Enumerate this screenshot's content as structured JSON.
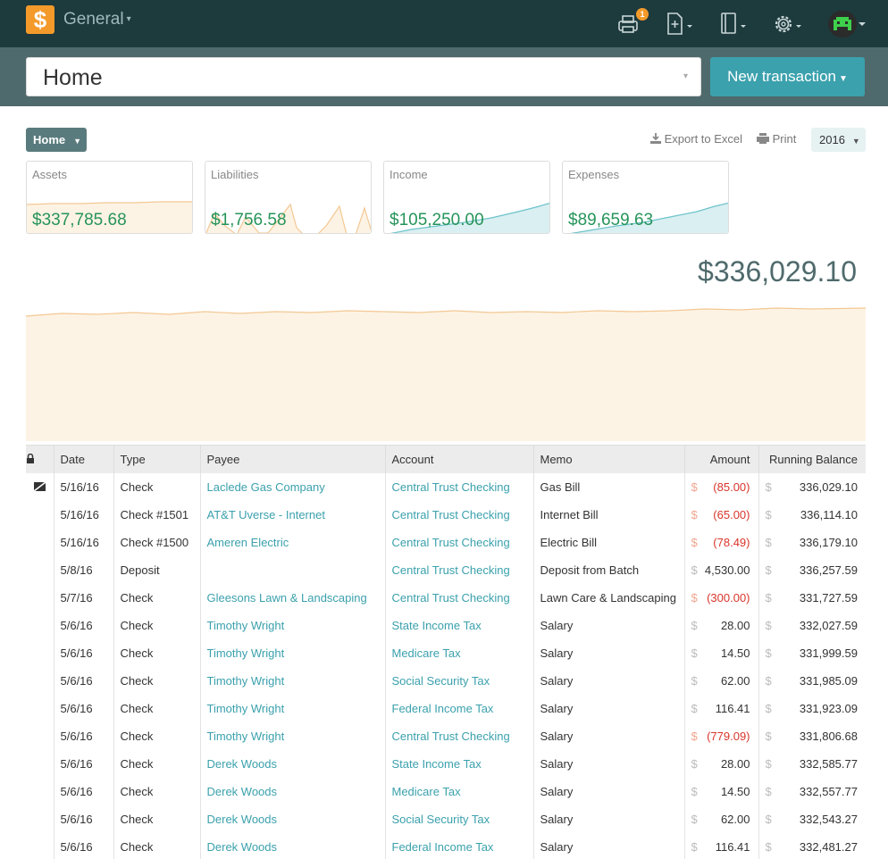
{
  "topbar": {
    "logo_glyph": "$",
    "company": "General",
    "caret": "▾",
    "print_badge": "1",
    "icons": [
      "printer-icon",
      "new-document-icon",
      "ledger-icon",
      "gear-icon",
      "user-avatar"
    ]
  },
  "search": {
    "value": "Home",
    "arrow": "▾",
    "new_transaction_label": "New transaction"
  },
  "toolbar": {
    "home_button": "Home",
    "export_label": "Export to Excel",
    "print_label": "Print",
    "year": "2016"
  },
  "cards": [
    {
      "label": "Assets",
      "amount": "$337,785.68"
    },
    {
      "label": "Liabilities",
      "amount": "$1,756.58"
    },
    {
      "label": "Income",
      "amount": "$105,250.00"
    },
    {
      "label": "Expenses",
      "amount": "$89,659.63"
    }
  ],
  "balance": "$336,029.10",
  "table": {
    "headers": {
      "date": "Date",
      "type": "Type",
      "payee": "Payee",
      "account": "Account",
      "memo": "Memo",
      "amount": "Amount",
      "running": "Running Balance"
    },
    "currency": "$",
    "rows": [
      {
        "icon": true,
        "date": "5/16/16",
        "type": "Check",
        "payee": "Laclede Gas Company",
        "account": "Central Trust Checking",
        "memo": "Gas Bill",
        "amount": "(85.00)",
        "negative": true,
        "running": "336,029.10"
      },
      {
        "icon": false,
        "date": "5/16/16",
        "type": "Check #1501",
        "payee": "AT&T Uverse - Internet",
        "account": "Central Trust Checking",
        "memo": "Internet Bill",
        "amount": "(65.00)",
        "negative": true,
        "running": "336,114.10"
      },
      {
        "icon": false,
        "date": "5/16/16",
        "type": "Check #1500",
        "payee": "Ameren Electric",
        "account": "Central Trust Checking",
        "memo": "Electric Bill",
        "amount": "(78.49)",
        "negative": true,
        "running": "336,179.10"
      },
      {
        "icon": false,
        "date": "5/8/16",
        "type": "Deposit",
        "payee": "",
        "account": "Central Trust Checking",
        "memo": "Deposit from Batch",
        "amount": "4,530.00",
        "negative": false,
        "running": "336,257.59"
      },
      {
        "icon": false,
        "date": "5/7/16",
        "type": "Check",
        "payee": "Gleesons Lawn & Landscaping",
        "account": "Central Trust Checking",
        "memo": "Lawn Care & Landscaping",
        "amount": "(300.00)",
        "negative": true,
        "running": "331,727.59"
      },
      {
        "icon": false,
        "date": "5/6/16",
        "type": "Check",
        "payee": "Timothy Wright",
        "account": "State Income Tax",
        "memo": "Salary",
        "amount": "28.00",
        "negative": false,
        "running": "332,027.59"
      },
      {
        "icon": false,
        "date": "5/6/16",
        "type": "Check",
        "payee": "Timothy Wright",
        "account": "Medicare Tax",
        "memo": "Salary",
        "amount": "14.50",
        "negative": false,
        "running": "331,999.59"
      },
      {
        "icon": false,
        "date": "5/6/16",
        "type": "Check",
        "payee": "Timothy Wright",
        "account": "Social Security Tax",
        "memo": "Salary",
        "amount": "62.00",
        "negative": false,
        "running": "331,985.09"
      },
      {
        "icon": false,
        "date": "5/6/16",
        "type": "Check",
        "payee": "Timothy Wright",
        "account": "Federal Income Tax",
        "memo": "Salary",
        "amount": "116.41",
        "negative": false,
        "running": "331,923.09"
      },
      {
        "icon": false,
        "date": "5/6/16",
        "type": "Check",
        "payee": "Timothy Wright",
        "account": "Central Trust Checking",
        "memo": "Salary",
        "amount": "(779.09)",
        "negative": true,
        "running": "331,806.68"
      },
      {
        "icon": false,
        "date": "5/6/16",
        "type": "Check",
        "payee": "Derek Woods",
        "account": "State Income Tax",
        "memo": "Salary",
        "amount": "28.00",
        "negative": false,
        "running": "332,585.77"
      },
      {
        "icon": false,
        "date": "5/6/16",
        "type": "Check",
        "payee": "Derek Woods",
        "account": "Medicare Tax",
        "memo": "Salary",
        "amount": "14.50",
        "negative": false,
        "running": "332,557.77"
      },
      {
        "icon": false,
        "date": "5/6/16",
        "type": "Check",
        "payee": "Derek Woods",
        "account": "Social Security Tax",
        "memo": "Salary",
        "amount": "62.00",
        "negative": false,
        "running": "332,543.27"
      },
      {
        "icon": false,
        "date": "5/6/16",
        "type": "Check",
        "payee": "Derek Woods",
        "account": "Federal Income Tax",
        "memo": "Salary",
        "amount": "116.41",
        "negative": false,
        "running": "332,481.27"
      }
    ]
  },
  "colors": {
    "topbar": "#1d3a3d",
    "accent": "#3ba1ad",
    "positive_amount": "#26945a",
    "negative_amount": "#d9352b",
    "asset_fill": "#fdf3e4",
    "asset_line": "#f3c894",
    "income_fill": "#daeff1",
    "income_line": "#6cc3cc"
  }
}
